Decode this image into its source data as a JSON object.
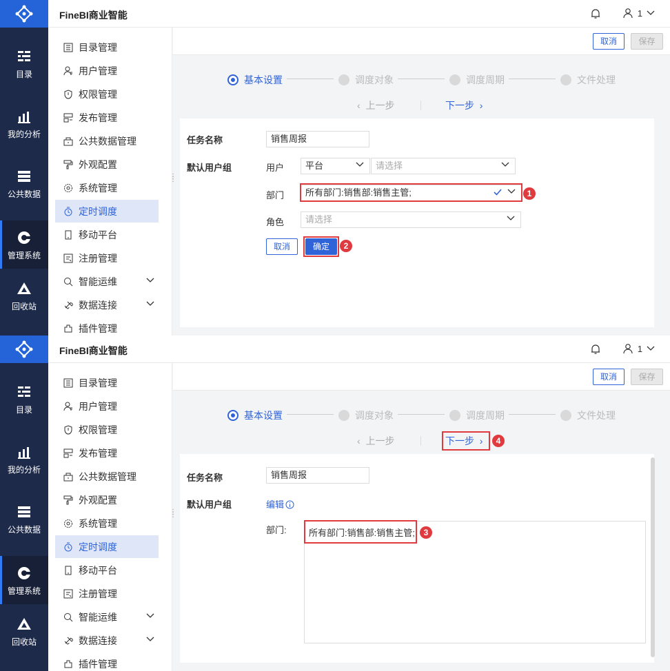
{
  "app": {
    "title": "FineBI商业智能",
    "user_name": "1"
  },
  "rail": {
    "items": [
      {
        "label": "目录",
        "icon": "catalog-icon"
      },
      {
        "label": "我的分析",
        "icon": "analysis-icon"
      },
      {
        "label": "公共数据",
        "icon": "public-data-icon"
      },
      {
        "label": "管理系统",
        "icon": "admin-icon"
      },
      {
        "label": "回收站",
        "icon": "recycle-icon"
      }
    ]
  },
  "menu": {
    "items": [
      {
        "label": "目录管理",
        "icon": "list-icon"
      },
      {
        "label": "用户管理",
        "icon": "user-icon"
      },
      {
        "label": "权限管理",
        "icon": "shield-icon"
      },
      {
        "label": "发布管理",
        "icon": "publish-icon"
      },
      {
        "label": "公共数据管理",
        "icon": "database-icon"
      },
      {
        "label": "外观配置",
        "icon": "paint-icon"
      },
      {
        "label": "系统管理",
        "icon": "gear-icon"
      },
      {
        "label": "定时调度",
        "icon": "clock-icon"
      },
      {
        "label": "移动平台",
        "icon": "mobile-icon"
      },
      {
        "label": "注册管理",
        "icon": "register-icon"
      },
      {
        "label": "智能运维",
        "icon": "ops-icon"
      },
      {
        "label": "数据连接",
        "icon": "link-icon"
      },
      {
        "label": "插件管理",
        "icon": "plugin-icon"
      }
    ]
  },
  "toolbar": {
    "cancel_label": "取消",
    "save_label": "保存"
  },
  "steps": [
    "基本设置",
    "调度对象",
    "调度周期",
    "文件处理"
  ],
  "nav": {
    "prev_label": "上一步",
    "next_label": "下一步"
  },
  "form": {
    "task_name_label": "任务名称",
    "task_name_value": "销售周报",
    "default_group_label": "默认用户组",
    "user_label": "用户",
    "platform_value": "平台",
    "select_placeholder": "请选择",
    "dept_label": "部门",
    "dept_value": "所有部门:销售部:销售主管;",
    "role_label": "角色",
    "role_placeholder": "请选择",
    "cancel_label": "取消",
    "confirm_label": "确定",
    "edit_label": "编辑",
    "dept_label_colon": "部门:",
    "dept_text": "所有部门:销售部:销售主管;"
  },
  "badges": [
    "1",
    "2",
    "3",
    "4"
  ],
  "colors": {
    "accent": "#2f63d8",
    "rail": "#1e2a4a",
    "logo_bg": "#2463d8",
    "highlight": "#e0393e"
  }
}
